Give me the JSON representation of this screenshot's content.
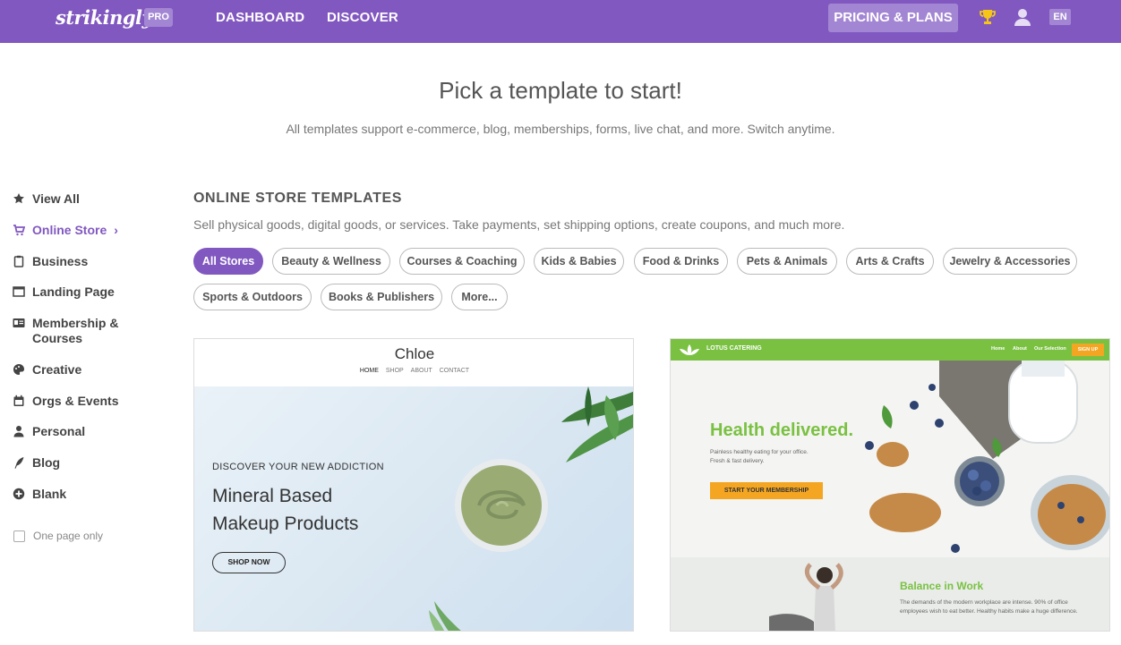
{
  "header": {
    "logo": "strikingly",
    "pro_badge": "PRO",
    "nav": [
      "DASHBOARD",
      "DISCOVER"
    ],
    "pricing_label": "PRICING & PLANS",
    "language": "EN"
  },
  "hero": {
    "title": "Pick a template to start!",
    "subtitle": "All templates support e-commerce, blog, memberships, forms, live chat, and more. Switch anytime."
  },
  "sidebar": {
    "items": [
      {
        "label": "View All",
        "icon": "star-icon"
      },
      {
        "label": "Online Store",
        "icon": "cart-icon",
        "active": true
      },
      {
        "label": "Business",
        "icon": "clipboard-icon"
      },
      {
        "label": "Landing Page",
        "icon": "window-icon"
      },
      {
        "label": "Membership & Courses",
        "icon": "id-card-icon"
      },
      {
        "label": "Creative",
        "icon": "palette-icon"
      },
      {
        "label": "Orgs & Events",
        "icon": "calendar-icon"
      },
      {
        "label": "Personal",
        "icon": "person-icon"
      },
      {
        "label": "Blog",
        "icon": "quill-icon"
      },
      {
        "label": "Blank",
        "icon": "plus-circle-icon"
      }
    ],
    "one_page_label": "One page only"
  },
  "section": {
    "title": "ONLINE STORE TEMPLATES",
    "description": "Sell physical goods, digital goods, or services. Take payments, set shipping options, create coupons, and much more.",
    "filters": [
      "All Stores",
      "Beauty & Wellness",
      "Courses & Coaching",
      "Kids & Babies",
      "Food & Drinks",
      "Pets & Animals",
      "Arts & Crafts",
      "Jewelry & Accessories",
      "Sports & Outdoors",
      "Books & Publishers",
      "More..."
    ],
    "active_filter": "All Stores"
  },
  "templates": [
    {
      "brand": "Chloe",
      "nav": [
        "HOME",
        "SHOP",
        "ABOUT",
        "CONTACT"
      ],
      "kicker": "DISCOVER YOUR NEW ADDICTION",
      "headline_1": "Mineral Based",
      "headline_2": "Makeup Products",
      "button": "SHOP NOW"
    },
    {
      "brand": "LOTUS CATERING",
      "nav": [
        "Home",
        "About",
        "Our Selection"
      ],
      "signup": "SIGN UP",
      "headline": "Health delivered.",
      "sub_1": "Painless healthy eating for your office.",
      "sub_2": "Fresh & fast delivery.",
      "button": "START YOUR MEMBERSHIP",
      "lower_title": "Balance in Work",
      "lower_body": "The demands of the modern workplace are intense. 90% of office employees wish to eat better. Healthy habits make a huge difference."
    }
  ],
  "colors": {
    "brand_purple": "#8158c0",
    "badge_purple": "#a386d3",
    "lotus_green": "#7ac142",
    "lotus_orange": "#f4a623"
  }
}
